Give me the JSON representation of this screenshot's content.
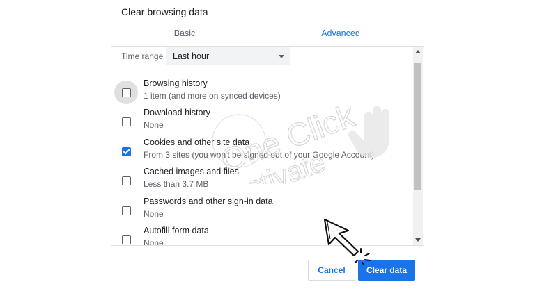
{
  "dialog": {
    "title": "Clear browsing data"
  },
  "tabs": [
    {
      "label": "Basic"
    },
    {
      "label": "Advanced"
    }
  ],
  "time_range": {
    "label": "Time range",
    "value": "Last hour"
  },
  "items": [
    {
      "title": "Browsing history",
      "subtitle": "1 item (and more on synced devices)",
      "checked": false
    },
    {
      "title": "Download history",
      "subtitle": "None",
      "checked": false
    },
    {
      "title": "Cookies and other site data",
      "subtitle": "From 3 sites (you won't be signed out of your Google Account)",
      "checked": true
    },
    {
      "title": "Cached images and files",
      "subtitle": "Less than 3.7 MB",
      "checked": false
    },
    {
      "title": "Passwords and other sign-in data",
      "subtitle": "None",
      "checked": false
    },
    {
      "title": "Autofill form data",
      "subtitle": "None",
      "checked": false
    }
  ],
  "buttons": {
    "cancel": "Cancel",
    "clear": "Clear data"
  },
  "watermark": {
    "line1": "One Click",
    "line2": "Activate"
  },
  "colors": {
    "accent": "#1a73e8",
    "text": "#202124",
    "muted": "#5f6368",
    "divider": "#e0e0e0"
  },
  "icons": {
    "select_caret": "caret-down-icon",
    "checkbox_checked": "checkmark-icon",
    "pointer": "arrow-cursor-icon",
    "watermark_hand": "hand-icon"
  }
}
